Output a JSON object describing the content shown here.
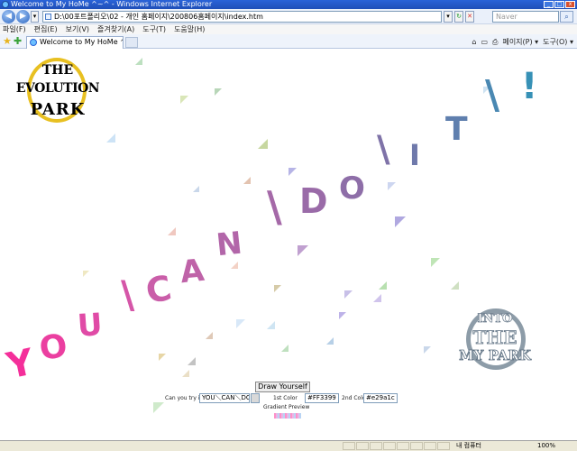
{
  "window": {
    "title": "Welcome to My HoMe ^~^ - Windows Internet Explorer",
    "buttons": [
      "_",
      "□",
      "x"
    ]
  },
  "addressbar": {
    "back_glyph": "◀",
    "forward_glyph": "▶",
    "url": "D:\\00포트폴리오\\02 - 개인 홈페이지\\200806홈페이지\\index.htm",
    "search_placeholder": "Naver",
    "search_glyph": "⌕"
  },
  "menubar": {
    "items": [
      "파일(F)",
      "편집(E)",
      "보기(V)",
      "즐겨찾기(A)",
      "도구(T)",
      "도움말(H)"
    ]
  },
  "favbar": {
    "tab_label": "Welcome to My HoMe ^~^",
    "commands": [
      "⌂",
      "▭",
      "⎙",
      "페이지(P) ▾",
      "도구(O) ▾"
    ]
  },
  "page": {
    "logo_evolution": {
      "line1": "THE",
      "line2": "EVOLUTION",
      "line3": "PARK"
    },
    "logo_into": {
      "line1": "INTO",
      "line2": "THE",
      "line3": "MY PARK"
    },
    "gradient_letters": [
      {
        "char": "Y",
        "color": "#f42f9a"
      },
      {
        "char": "O",
        "color": "#eb3fa0"
      },
      {
        "char": "U",
        "color": "#e04ba6"
      },
      {
        "char": "\\",
        "color": "#d556a8"
      },
      {
        "char": "C",
        "color": "#ca5ea9"
      },
      {
        "char": "A",
        "color": "#bf63a8"
      },
      {
        "char": "N",
        "color": "#b266a9"
      },
      {
        "char": "\\",
        "color": "#a569a8"
      },
      {
        "char": "D",
        "color": "#9a6ba8"
      },
      {
        "char": "O",
        "color": "#8e6ea8"
      },
      {
        "char": "\\",
        "color": "#7f73a8"
      },
      {
        "char": "I",
        "color": "#6f79ab"
      },
      {
        "char": "T",
        "color": "#5f7fae"
      },
      {
        "char": "\\",
        "color": "#4a88b2"
      },
      {
        "char": "!",
        "color": "#3791b6"
      }
    ],
    "form": {
      "draw_button": "Draw Yourself",
      "prompt_label": "Can you try it ?",
      "text_value": "YOU＼CAN＼DO＼IT＼!",
      "color1_label": "1st Color",
      "color1_value": "#FF3399",
      "color2_label": "2nd Color",
      "color2_value": "#e29a1c",
      "preview_label": "Gradient Preview"
    }
  },
  "statusbar": {
    "zone": "내 컴퓨터",
    "zoom": "100%"
  }
}
